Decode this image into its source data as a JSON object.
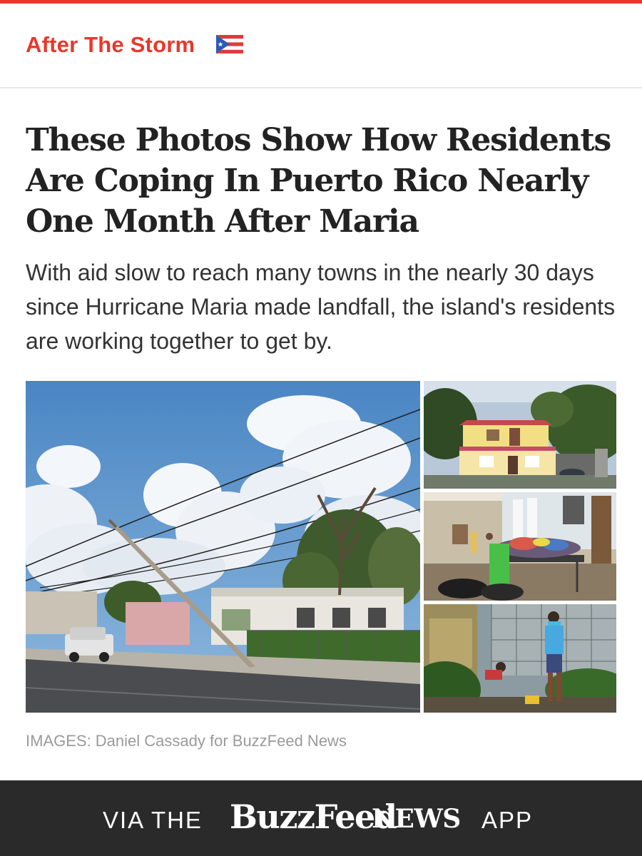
{
  "colors": {
    "accent": "#e8382b",
    "banner_bg": "#2a2a2a"
  },
  "section": {
    "title": "After The Storm",
    "flag_icon": "puerto-rico-flag-icon"
  },
  "article": {
    "headline": "These Photos Show How Residents Are Coping In Puerto Rico Nearly One Month After Maria",
    "dek": "With aid slow to reach many towns in the nearly 30 days since Hurricane Maria made landfall, the island's residents are working together to get by.",
    "credit": "IMAGES: Daniel Cassady for BuzzFeed News"
  },
  "banner": {
    "via": "VIA THE",
    "brand": "BuzzFeed",
    "news": "NEWS",
    "app": "APP"
  }
}
